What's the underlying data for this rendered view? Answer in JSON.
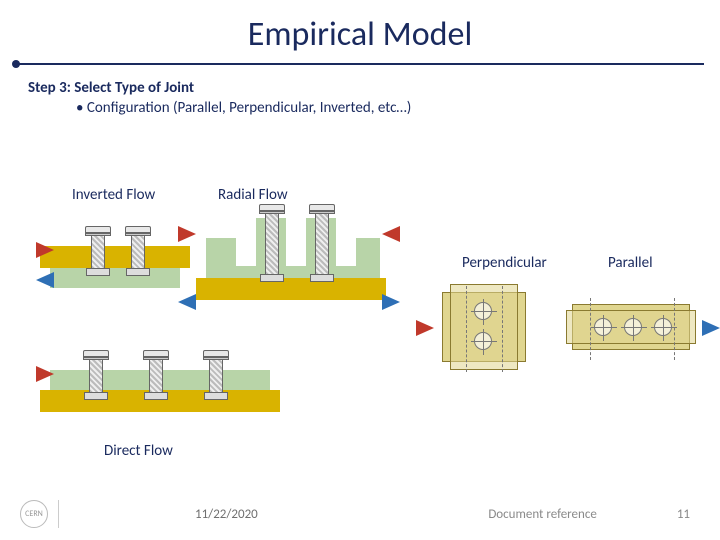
{
  "title": "Empirical Model",
  "step": {
    "heading": "Step 3: Select Type of Joint",
    "bullet": "Configuration (Parallel, Perpendicular, Inverted, etc…)"
  },
  "labels": {
    "inverted": "Inverted Flow",
    "radial": "Radial Flow",
    "direct": "Direct Flow",
    "perpendicular": "Perpendicular",
    "parallel": "Parallel"
  },
  "footer": {
    "logo": "CERN",
    "date": "11/22/2020",
    "reference": "Document reference",
    "page": "11"
  },
  "colors": {
    "accent": "#1a2a5e",
    "gold": "#d9b300",
    "green": "#b8d4a8",
    "red": "#c0392b",
    "blue": "#2e6fb5"
  }
}
